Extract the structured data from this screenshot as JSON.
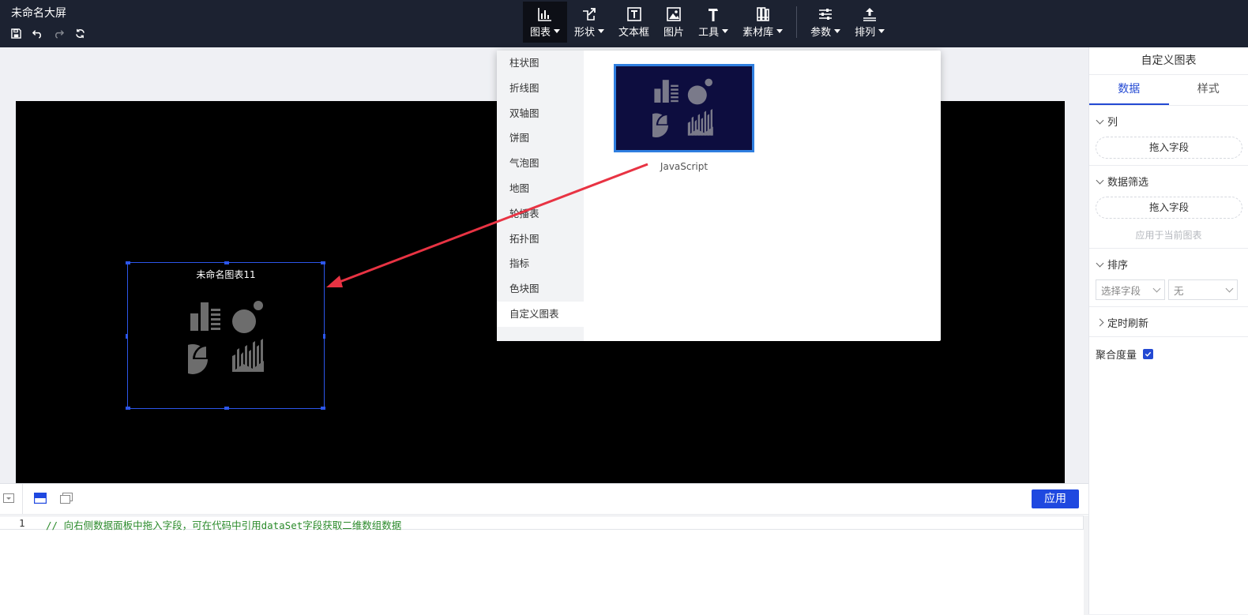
{
  "app": {
    "title": "未命名大屏"
  },
  "quick_tools": [
    {
      "name": "save-icon",
      "icon": "floppy-disk",
      "enabled": true
    },
    {
      "name": "undo-icon",
      "icon": "undo-arrow",
      "enabled": true
    },
    {
      "name": "redo-icon",
      "icon": "redo-arrow",
      "enabled": false
    },
    {
      "name": "refresh-icon",
      "icon": "refresh-arrows",
      "enabled": true
    }
  ],
  "toolbar": {
    "chart": "图表",
    "shape": "形状",
    "textbox": "文本框",
    "image": "图片",
    "tools": "工具",
    "assets": "素材库",
    "params": "参数",
    "arrange": "排列"
  },
  "chart_menu": {
    "items": [
      "柱状图",
      "折线图",
      "双轴图",
      "饼图",
      "气泡图",
      "地图",
      "轮播表",
      "拓扑图",
      "指标",
      "色块图",
      "自定义图表"
    ],
    "selected": "自定义图表",
    "tile_label": "JavaScript"
  },
  "widget": {
    "title": "未命名图表11"
  },
  "right_panel": {
    "title": "自定义图表",
    "tabs": [
      "数据",
      "样式"
    ],
    "active_tab": "数据",
    "columns_label": "列",
    "drop_field": "拖入字段",
    "filter_label": "数据筛选",
    "filter_drop_field": "拖入字段",
    "apply_hint": "应用于当前图表",
    "sort_label": "排序",
    "sort_field_placeholder": "选择字段",
    "sort_order": "无",
    "refresh_label": "定时刷新",
    "aggregate_label": "聚合度量",
    "aggregate_checked": true
  },
  "editor": {
    "apply": "应用",
    "line_number": "1",
    "code": "// 向右侧数据面板中拖入字段，可在代码中引用dataSet字段获取二维数组数据"
  },
  "colors": {
    "topbar": "#1c2231",
    "accent": "#2349d3",
    "arrow": "#e83343",
    "tile_border": "#2f7fe0",
    "code_comment": "#2a8a2a"
  }
}
